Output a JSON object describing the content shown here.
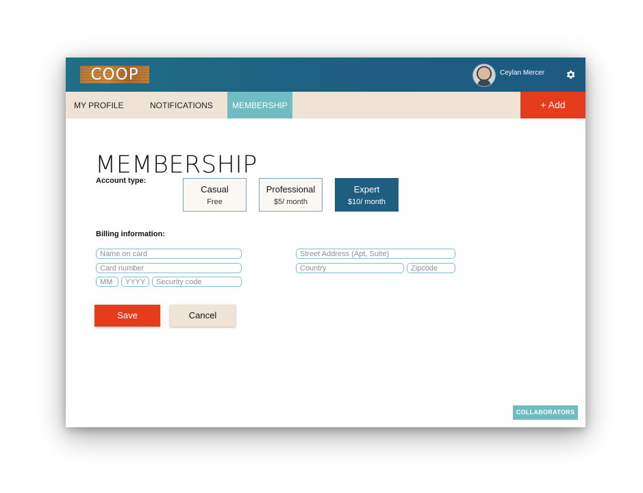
{
  "app": {
    "logo_text": "COOP"
  },
  "user": {
    "name": "Ceylan Mercer"
  },
  "nav": {
    "tabs": [
      {
        "label": "MY PROFILE",
        "active": false
      },
      {
        "label": "NOTIFICATIONS",
        "active": false
      },
      {
        "label": "MEMBERSHIP",
        "active": true
      }
    ],
    "add_label": "+ Add"
  },
  "page": {
    "title": "MEMBERSHIP"
  },
  "account": {
    "label": "Account type:",
    "plans": [
      {
        "name": "Casual",
        "price": "Free",
        "selected": false
      },
      {
        "name": "Professional",
        "price": "$5/ month",
        "selected": false
      },
      {
        "name": "Expert",
        "price": "$10/ month",
        "selected": true
      }
    ]
  },
  "billing": {
    "label": "Billing information:",
    "fields": {
      "name_on_card": {
        "placeholder": "Name on card",
        "value": ""
      },
      "card_number": {
        "placeholder": "Card number",
        "value": ""
      },
      "month": {
        "placeholder": "MM",
        "value": ""
      },
      "year": {
        "placeholder": "YYYY",
        "value": ""
      },
      "security_code": {
        "placeholder": "Security code",
        "value": ""
      },
      "street": {
        "placeholder": "Street Address (Apt, Suite)",
        "value": ""
      },
      "country": {
        "placeholder": "Country",
        "value": ""
      },
      "zipcode": {
        "placeholder": "Zipcode",
        "value": ""
      }
    }
  },
  "actions": {
    "save_label": "Save",
    "cancel_label": "Cancel",
    "collaborators_label": "COLLABORATORS"
  },
  "colors": {
    "header": "#1e5f82",
    "nav_bg": "#efe3d6",
    "active_tab": "#6fbcc3",
    "accent_red": "#e53c1d",
    "selected_plan": "#1f5e80",
    "field_border": "#7cc0cf"
  },
  "icons": {
    "settings": "gear-icon",
    "avatar": "user-avatar"
  }
}
